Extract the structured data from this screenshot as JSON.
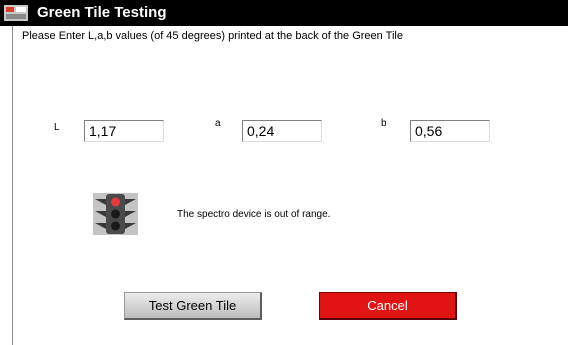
{
  "window": {
    "title": "Green Tile Testing",
    "icon": "app-logo-icon"
  },
  "instructions": "Please Enter L,a,b values (of 45 degrees) printed at the back of the Green Tile",
  "fields": {
    "L": {
      "label": "L",
      "value": "1,17"
    },
    "a": {
      "label": "a",
      "value": "0,24"
    },
    "b": {
      "label": "b",
      "value": "0,56"
    }
  },
  "status": {
    "icon": "traffic-light-icon",
    "message": "The spectro device is out of range."
  },
  "buttons": {
    "test": "Test Green Tile",
    "cancel": "Cancel"
  },
  "colors": {
    "titlebar": "#000000",
    "cancel": "#e11414",
    "light_red": "#e83a3a"
  }
}
